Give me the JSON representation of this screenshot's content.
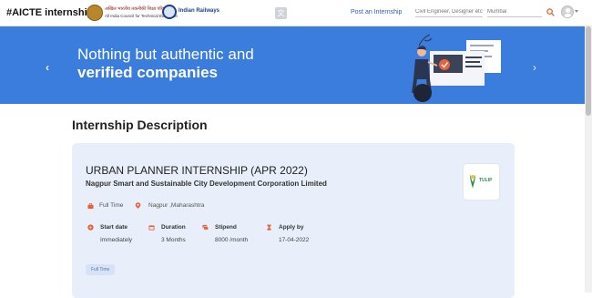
{
  "header": {
    "brand": "#AICTE internships",
    "aicte_line1": "अखिल भारतीय तकनीकी शिक्षा परिषद",
    "aicte_line2": "All India Council for Technical Education",
    "railways": "Indian Railways",
    "post_link": "Post an Internship",
    "search_placeholder": "Civil Engineer, Designer etc.",
    "location_placeholder": "Mumbai"
  },
  "banner": {
    "line1": "Nothing but authentic and",
    "line2": "verified companies",
    "prev": "‹",
    "next": "›"
  },
  "section_title": "Internship Description",
  "internship": {
    "title": "URBAN PLANNER INTERNSHIP (APR 2022)",
    "company": "Nagpur Smart and Sustainable City Development Corporation Limited",
    "logo_text": "TULIP",
    "type": "Full Time",
    "location": "Nagpur ,Maharashtra",
    "details": [
      {
        "label": "Start date",
        "value": "Immediately"
      },
      {
        "label": "Duration",
        "value": "3 Months"
      },
      {
        "label": "Stipend",
        "value": "8000 /month"
      },
      {
        "label": "Apply by",
        "value": "17-04-2022"
      }
    ],
    "tag": "Full Time"
  },
  "colors": {
    "banner": "#3b7ddd",
    "accent": "#e8633a",
    "card": "#e8effa"
  }
}
